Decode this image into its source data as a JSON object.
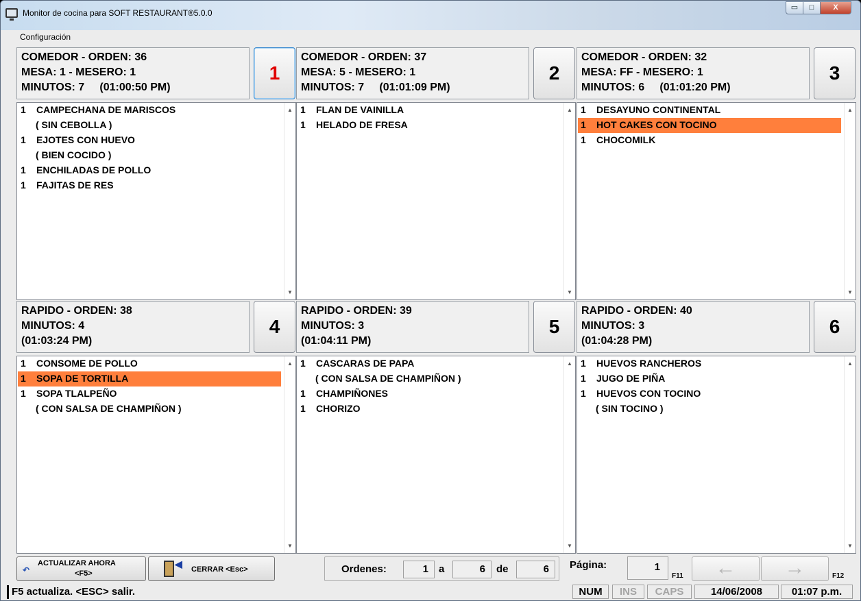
{
  "window": {
    "title": "Monitor de cocina para SOFT RESTAURANT®5.0.0",
    "min_glyph": "▭",
    "max_glyph": "□",
    "close_glyph": "X"
  },
  "menu": {
    "configuracion": "Configuración"
  },
  "panels": [
    {
      "number": "1",
      "active": true,
      "header": [
        "COMEDOR - ORDEN: 36",
        "MESA: 1 - MESERO: 1",
        "MINUTOS: 7     (01:00:50 PM)"
      ],
      "items": [
        {
          "qty": "1",
          "name": "CAMPECHANA DE MARISCOS",
          "mod": "( SIN CEBOLLA )"
        },
        {
          "qty": "1",
          "name": "EJOTES CON HUEVO",
          "mod": "( BIEN COCIDO )"
        },
        {
          "qty": "1",
          "name": "ENCHILADAS DE POLLO"
        },
        {
          "qty": "1",
          "name": "FAJITAS DE RES"
        }
      ]
    },
    {
      "number": "2",
      "header": [
        "COMEDOR - ORDEN: 37",
        "MESA: 5 - MESERO: 1",
        "MINUTOS: 7     (01:01:09 PM)"
      ],
      "items": [
        {
          "qty": "1",
          "name": "FLAN DE VAINILLA"
        },
        {
          "qty": "1",
          "name": "HELADO DE FRESA"
        }
      ]
    },
    {
      "number": "3",
      "header": [
        "COMEDOR - ORDEN: 32",
        "MESA: FF - MESERO: 1",
        "MINUTOS: 6     (01:01:20 PM)"
      ],
      "items": [
        {
          "qty": "1",
          "name": "DESAYUNO CONTINENTAL"
        },
        {
          "qty": "1",
          "name": "HOT CAKES CON TOCINO",
          "highlight": true
        },
        {
          "qty": "1",
          "name": "CHOCOMILK"
        }
      ]
    },
    {
      "number": "4",
      "header": [
        "RAPIDO - ORDEN: 38",
        "MINUTOS: 4",
        "(01:03:24 PM)"
      ],
      "items": [
        {
          "qty": "1",
          "name": "CONSOME DE POLLO"
        },
        {
          "qty": "1",
          "name": "SOPA DE TORTILLA",
          "highlight": true
        },
        {
          "qty": "1",
          "name": "SOPA TLALPEÑO",
          "mod": "( CON SALSA DE CHAMPIÑON )"
        }
      ]
    },
    {
      "number": "5",
      "header": [
        "RAPIDO - ORDEN: 39",
        "MINUTOS: 3",
        "(01:04:11 PM)"
      ],
      "items": [
        {
          "qty": "1",
          "name": "CASCARAS DE PAPA",
          "mod": "( CON SALSA DE CHAMPIÑON )"
        },
        {
          "qty": "1",
          "name": "CHAMPIÑONES"
        },
        {
          "qty": "1",
          "name": "CHORIZO"
        }
      ]
    },
    {
      "number": "6",
      "header": [
        "RAPIDO - ORDEN: 40",
        "MINUTOS: 3",
        "(01:04:28 PM)"
      ],
      "items": [
        {
          "qty": "1",
          "name": "HUEVOS RANCHEROS"
        },
        {
          "qty": "1",
          "name": "JUGO DE PIÑA"
        },
        {
          "qty": "1",
          "name": "HUEVOS CON TOCINO",
          "mod": "( SIN TOCINO )"
        }
      ]
    }
  ],
  "scroll_arrows": {
    "up": "▲",
    "down": "▼"
  },
  "toolbar": {
    "actualizar_line1": "ACTUALIZAR AHORA",
    "actualizar_line2": "<F5>",
    "actualizar_icon": "↶",
    "cerrar_label": "CERRAR <Esc>",
    "cerrar_arrow": "◀",
    "ordenes_label": "Ordenes:",
    "ordenes_from": "1",
    "a_label": "a",
    "ordenes_to": "6",
    "de_label": "de",
    "ordenes_total": "6",
    "pagina_label": "Página:",
    "pagina_value": "1",
    "f11": "F11",
    "f12": "F12",
    "prev_glyph": "←",
    "next_glyph": "→"
  },
  "status": {
    "text": "F5 actualiza. <ESC> salir.",
    "num": "NUM",
    "ins": "INS",
    "caps": "CAPS",
    "date": "14/06/2008",
    "time": "01:07 p.m."
  },
  "colors": {
    "highlight": "#ff7f3c",
    "active_number": "#e00000"
  }
}
